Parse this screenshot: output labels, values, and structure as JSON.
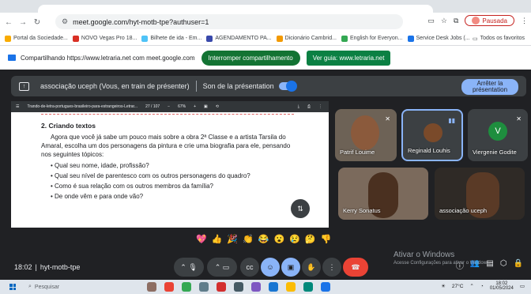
{
  "browser": {
    "url": "meet.google.com/hyt-motb-tpe?authuser=1",
    "profile_status": "Pausada",
    "bookmarks": [
      {
        "label": "Portal da Sociedade...",
        "color": "#f9ab00"
      },
      {
        "label": "NOVO Vegas Pro 18...",
        "color": "#d93025"
      },
      {
        "label": "Bilhete de ida - Em...",
        "color": "#4fc3f7"
      },
      {
        "label": "AGENDAMENTO PA...",
        "color": "#3949ab"
      },
      {
        "label": "Dicionário Cambrid...",
        "color": "#f29900"
      },
      {
        "label": "English for Everyon...",
        "color": "#34a853"
      },
      {
        "label": "Service Desk Jobs (...",
        "color": "#1a73e8"
      }
    ],
    "all_bookmarks": "Todos os favoritos"
  },
  "share_bar": {
    "text": "Compartilhando https://www.letraria.net com meet.google.com",
    "stop_label": "Interromper compartilhamento",
    "view_label": "Ver guia: www.letraria.net"
  },
  "presentation_bar": {
    "title": "associação uceph (Vous, en train de présenter)",
    "sound_label": "Son de la présentation",
    "stop_line1": "Arrêter la",
    "stop_line2": "présentation"
  },
  "document": {
    "toolbar_title": "Trando-de-letra-portugues-brasileiro-para-estrangeiros-Letrar...",
    "page_indicator": "27 / 107",
    "zoom": "67%",
    "heading": "2. Criando textos",
    "paragraph": "Agora que você já sabe um pouco mais sobre a obra 2ª Classe e a artista Tarsila do Amaral, escolha um dos personagens da pintura e crie uma biografia para ele, pensando nos seguintes tópicos:",
    "topics": [
      "Qual seu nome, idade, profissão?",
      "Qual seu nível de parentesco com os outros personagens do quadro?",
      "Como é sua relação com os outros membros da família?",
      "De onde vêm e para onde vão?"
    ]
  },
  "participants": [
    {
      "name": "Patrif Louime"
    },
    {
      "name": "Reginald Louhis"
    },
    {
      "name": "Viergenie Godite",
      "initial": "V"
    },
    {
      "name": "Kerry Sonatus"
    },
    {
      "name": "associação uceph"
    }
  ],
  "reactions": [
    "💖",
    "👍",
    "🎉",
    "👏",
    "😂",
    "😮",
    "😢",
    "🤔",
    "👎"
  ],
  "meeting": {
    "time": "18:02",
    "code": "hyt-motb-tpe"
  },
  "watermark": {
    "line1": "Ativar o Windows",
    "line2": "Acesse Configurações para ativar o Windows."
  },
  "taskbar": {
    "search_placeholder": "Pesquisar",
    "temperature": "27°C",
    "clock_time": "18:02",
    "clock_date": "01/05/2024"
  }
}
